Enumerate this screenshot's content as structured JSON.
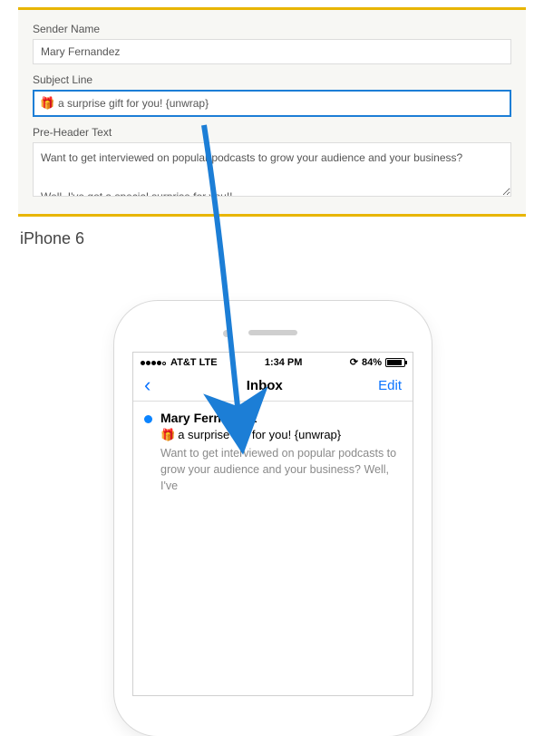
{
  "form": {
    "sender_label": "Sender Name",
    "sender_value": "Mary Fernandez",
    "subject_label": "Subject Line",
    "subject_value": "a surprise gift for you! {unwrap}",
    "subject_emoji": "🎁",
    "preheader_label": "Pre-Header Text",
    "preheader_value": "Want to get interviewed on popular podcasts to grow your audience and your business?\n\nWell, I've got a special surprise for you!!"
  },
  "device_label": "iPhone 6",
  "status": {
    "carrier": "AT&T  LTE",
    "time": "1:34 PM",
    "battery_pct": "84%",
    "orientation_glyph": "⟳"
  },
  "nav": {
    "back_glyph": "‹",
    "title": "Inbox",
    "edit": "Edit"
  },
  "mail": {
    "sender": "Mary Fernandez",
    "subject_emoji": "🎁",
    "subject": "a surprise gift for you! {unwrap}",
    "preview": "Want to get interviewed on popular podcasts to grow your audience and your business? Well, I've"
  }
}
